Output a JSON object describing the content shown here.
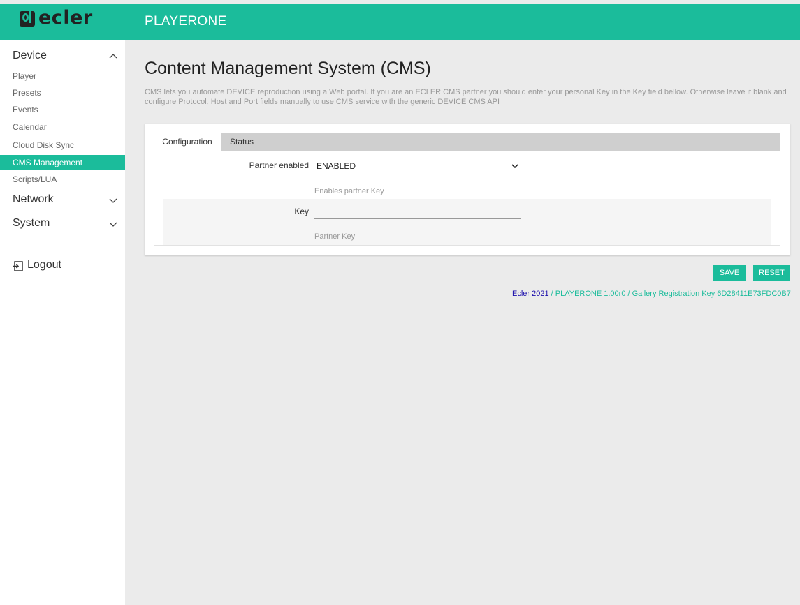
{
  "header": {
    "logo_text": "ecler",
    "app_title": "PLAYERONE"
  },
  "sidebar": {
    "device_label": "Device",
    "device_items": [
      {
        "label": "Player"
      },
      {
        "label": "Presets"
      },
      {
        "label": "Events"
      },
      {
        "label": "Calendar"
      },
      {
        "label": "Cloud Disk Sync"
      },
      {
        "label": "CMS Management",
        "active": true
      },
      {
        "label": "Scripts/LUA"
      }
    ],
    "network_label": "Network",
    "system_label": "System",
    "logout_label": "Logout"
  },
  "main": {
    "title": "Content Management System (CMS)",
    "description": "CMS lets you automate DEVICE reproduction using a Web portal. If you are an ECLER CMS partner you should enter your personal Key in the Key field bellow. Otherwise leave it blank and configure Protocol, Host and Port fields manually to use CMS service with the generic DEVICE CMS API",
    "tabs": [
      {
        "label": "Configuration",
        "active": true
      },
      {
        "label": "Status"
      }
    ],
    "partner_enabled": {
      "label": "Partner enabled",
      "value": "ENABLED",
      "help": "Enables partner Key"
    },
    "key": {
      "label": "Key",
      "value": "",
      "help": "Partner Key"
    }
  },
  "buttons": {
    "save_label": "SAVE",
    "reset_label": "RESET"
  },
  "footer": {
    "link_text": "Ecler 2021",
    "rest_text": " / PLAYERONE 1.00r0 / Gallery Registration Key 6D28411E73FDC0B7"
  },
  "colors": {
    "accent": "#1bbc9b",
    "background": "#ebebeb",
    "link": "#1a0dab"
  }
}
